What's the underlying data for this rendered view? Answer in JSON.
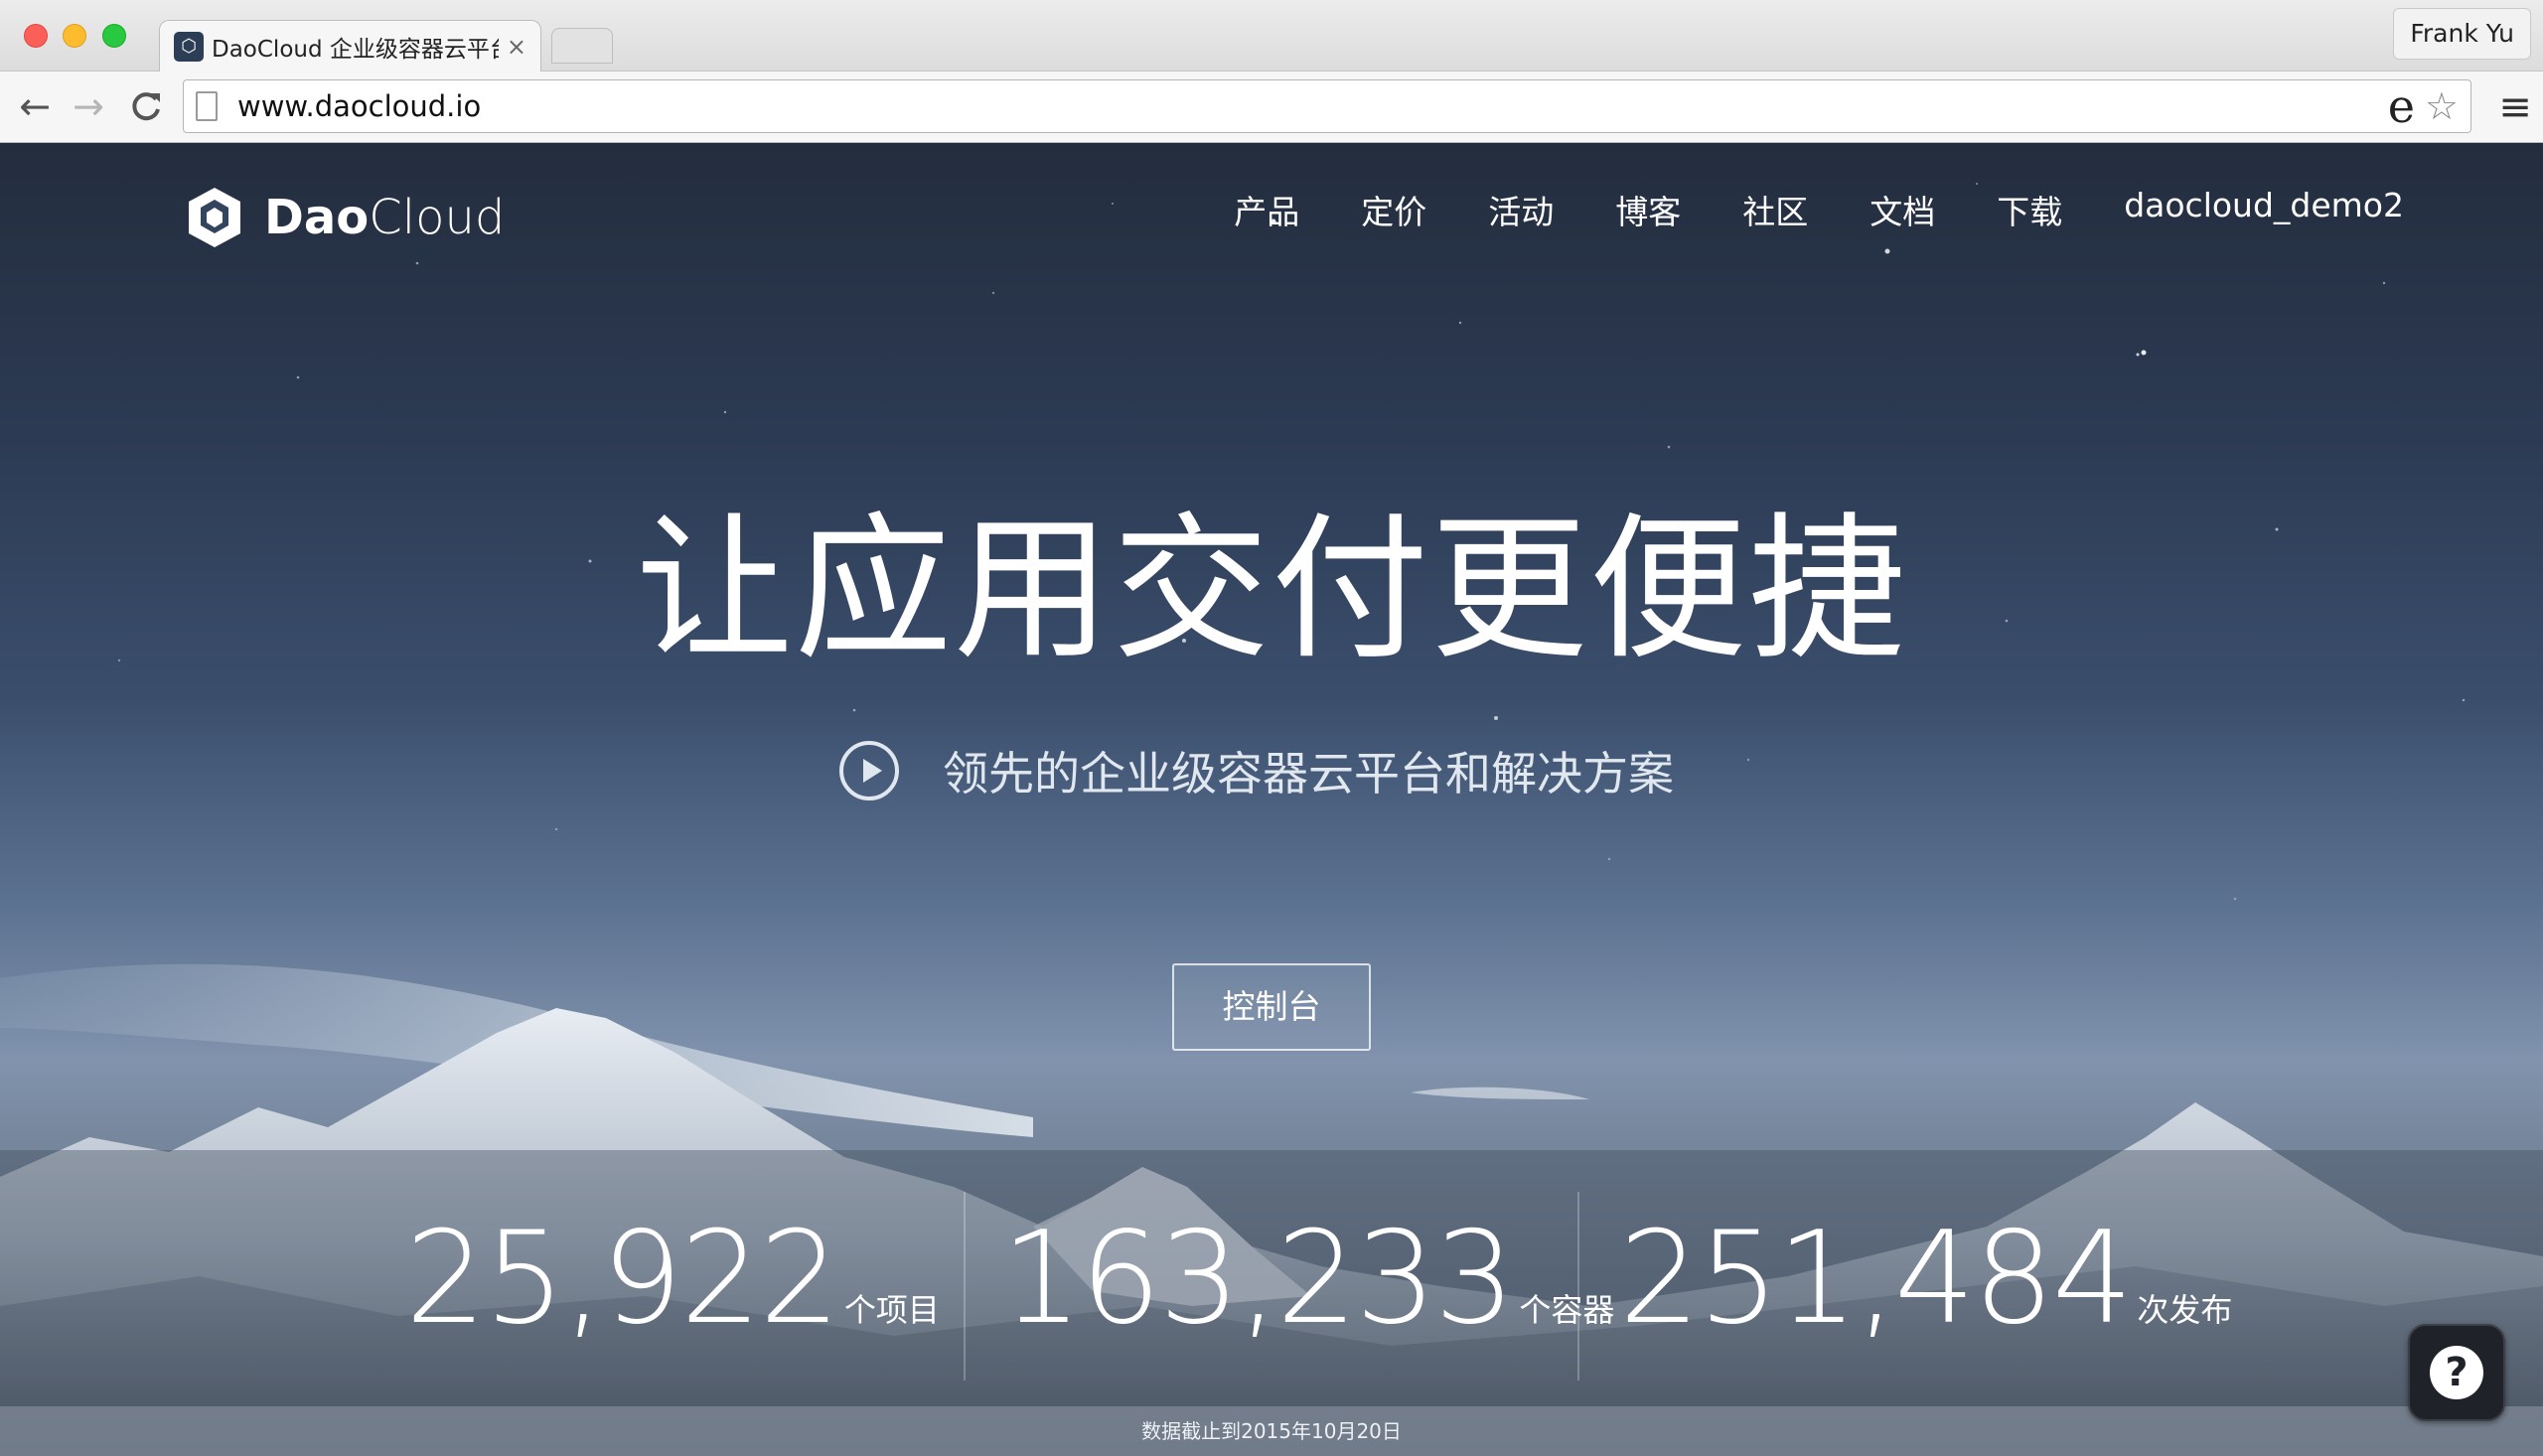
{
  "browser": {
    "tab_title": "DaoCloud 企业级容器云平台",
    "tab_close": "×",
    "profile_name": "Frank Yu",
    "url": "www.daocloud.io",
    "omnibox_extension": "e",
    "back": "←",
    "forward": "→",
    "reload": "C",
    "menu": "≡",
    "star": "☆"
  },
  "site": {
    "brand_bold": "Dao",
    "brand_light": "Cloud",
    "nav": [
      "产品",
      "定价",
      "活动",
      "博客",
      "社区",
      "文档",
      "下载",
      "daocloud_demo2"
    ]
  },
  "hero": {
    "title": "让应用交付更便捷",
    "subtitle": "领先的企业级容器云平台和解决方案",
    "cta": "控制台"
  },
  "stats": [
    {
      "value": "25,922",
      "unit": "个项目"
    },
    {
      "value": "163,233",
      "unit": "个容器"
    },
    {
      "value": "251,484",
      "unit": "次发布"
    }
  ],
  "footnote": "数据截止到2015年10月20日",
  "help": "?"
}
